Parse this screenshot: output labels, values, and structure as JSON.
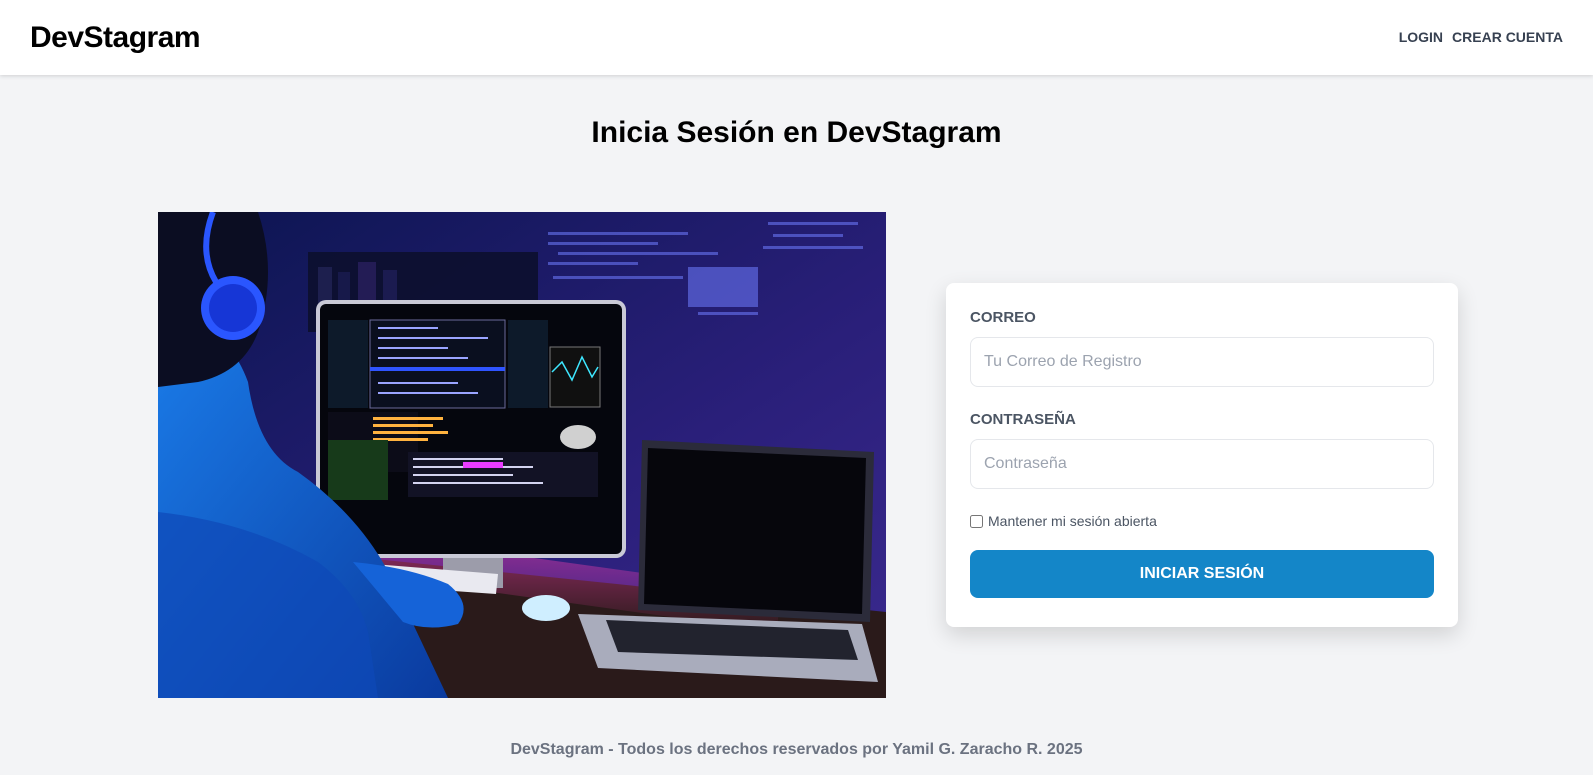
{
  "header": {
    "brand": "DevStagram",
    "nav": {
      "login": "LOGIN",
      "register": "CREAR CUENTA"
    }
  },
  "main": {
    "title": "Inicia Sesión en DevStagram"
  },
  "form": {
    "email": {
      "label": "CORREO",
      "placeholder": "Tu Correo de Registro",
      "value": ""
    },
    "password": {
      "label": "CONTRASEÑA",
      "placeholder": "Contraseña",
      "value": ""
    },
    "remember": {
      "label": "Mantener mi sesión abierta",
      "checked": false
    },
    "submit_label": "INICIAR SESIÓN"
  },
  "colors": {
    "accent": "#1486c8",
    "background": "#f3f4f6"
  },
  "footer": {
    "text": "DevStagram - Todos los derechos reservados por Yamil G. Zaracho R. 2025"
  }
}
